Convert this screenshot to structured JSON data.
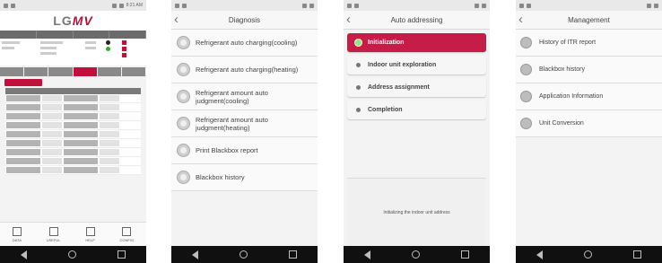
{
  "status_bar": {
    "time": "8:21 AM"
  },
  "screen1": {
    "logo_prefix": "LG",
    "logo_accent": "MV",
    "bottom_tabs": [
      "DATA",
      "USEFUL",
      "HELP",
      "CONFIG"
    ]
  },
  "screen2": {
    "title": "Diagnosis",
    "items": [
      "Refrigerant auto charging(cooling)",
      "Refrigerant auto charging(heating)",
      "Refrigerant amount auto judgment(cooling)",
      "Refrigerant amount auto judgment(heating)",
      "Print Blackbox report",
      "Blackbox history"
    ]
  },
  "screen3": {
    "title": "Auto addressing",
    "steps": [
      "Initialization",
      "Indoor unit exploration",
      "Address assignment",
      "Completion"
    ],
    "active_step": "Initialization",
    "message": "Initializing the indoor unit address"
  },
  "screen4": {
    "title": "Management",
    "items": [
      "History of ITR report",
      "Blackbox history",
      "Application Information",
      "Unit Conversion"
    ]
  },
  "colors": {
    "accent": "#c2103c",
    "active_dot": "#9be07b"
  }
}
